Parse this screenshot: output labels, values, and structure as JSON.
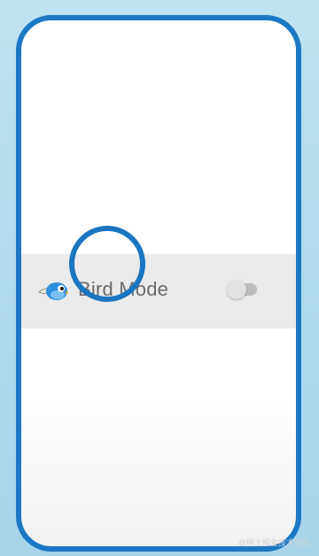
{
  "screen": {
    "background_color": "#b9dff0",
    "frame_color": "#1b78c4"
  },
  "settings_row": {
    "icon": "bird-icon",
    "label": "Bird Mode",
    "toggle": {
      "checked": false
    }
  },
  "tap_indicator": {
    "color": "#1b76c1"
  },
  "watermark": {
    "text": "@稀土掘金技术社区"
  }
}
